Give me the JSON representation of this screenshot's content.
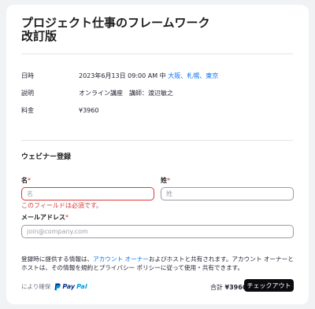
{
  "event": {
    "title": "プロジェクト仕事のフレームワーク　改訂版"
  },
  "info": {
    "date_label": "日時",
    "date_value": "2023年6月13日 09:00 AM 中",
    "date_cities": [
      "大阪",
      "札幌",
      "東京"
    ],
    "description_label": "説明",
    "description_value": "オンライン講座　講師：渡辺敏之",
    "fee_label": "料金",
    "fee_value": "¥3960"
  },
  "registration": {
    "section_title": "ウェビナー登録",
    "first_name_label": "名",
    "first_name_placeholder": "名",
    "first_name_error": "このフィールドは必須です。",
    "last_name_label": "姓",
    "last_name_placeholder": "姓",
    "email_label": "メールアドレス",
    "email_placeholder": "join@company.com",
    "required_mark": "*"
  },
  "notice": {
    "text_before": "登録時に提供する情報は、",
    "link": "アカウント オーナー",
    "text_after": "およびホストと共有されます。アカウント オーナーとホストは、その情報を規約とプライバシー ポリシーに従って使用・共有できます。"
  },
  "footer": {
    "secured_by": "により確保",
    "paypal_pay": "Pay",
    "paypal_pal": "Pal",
    "total_label": "合計",
    "total_value": "¥3960",
    "checkout_label": "チェックアウト"
  },
  "colors": {
    "link": "#0e71eb",
    "error": "#d93b3b",
    "button": "#0b0b0f",
    "paypal_dark": "#003087",
    "paypal_light": "#009cde"
  }
}
